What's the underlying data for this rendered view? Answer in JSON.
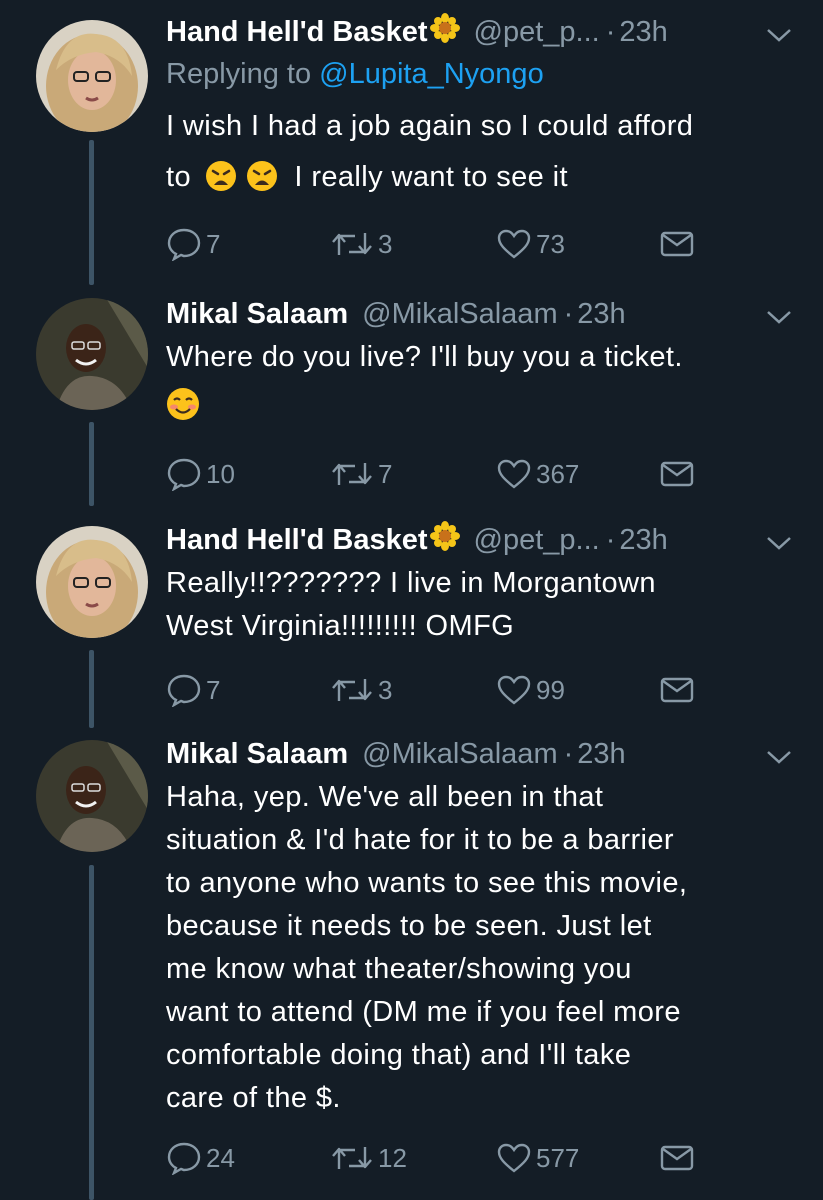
{
  "tweets": [
    {
      "name": "Hand Hell'd Basket",
      "handle": "@pet_p...",
      "dot": "·",
      "time": "23h",
      "replying_prefix": "Replying to ",
      "replying_to": "@Lupita_Nyongo",
      "lines": [
        "I wish I had a job again so I could afford",
        "to",
        "I really want to see it"
      ],
      "replies": "7",
      "retweets": "3",
      "likes": "73"
    },
    {
      "name": "Mikal Salaam",
      "handle": "@MikalSalaam",
      "dot": "·",
      "time": "23h",
      "lines": [
        "Where do you live? I'll buy you a ticket."
      ],
      "replies": "10",
      "retweets": "7",
      "likes": "367"
    },
    {
      "name": "Hand Hell'd Basket",
      "handle": "@pet_p...",
      "dot": "·",
      "time": "23h",
      "lines": [
        "Really!!??????? I live in Morgantown",
        "West Virginia!!!!!!!!! OMFG"
      ],
      "replies": "7",
      "retweets": "3",
      "likes": "99"
    },
    {
      "name": "Mikal Salaam",
      "handle": "@MikalSalaam",
      "dot": "·",
      "time": "23h",
      "lines": [
        "Haha, yep. We've all been in that",
        "situation & I'd hate for it to be a barrier",
        "to anyone who wants to see this movie,",
        "because it needs to be seen. Just let",
        "me know what theater/showing you",
        "want to attend (DM me if you feel more",
        "comfortable doing that) and I'll take",
        "care of the $."
      ],
      "replies": "24",
      "retweets": "12",
      "likes": "577"
    }
  ],
  "icons": {
    "reply": "reply-icon",
    "retweet": "retweet-icon",
    "like": "heart-icon",
    "dm": "envelope-icon",
    "caret": "chevron-down-icon",
    "flower": "sunflower-emoji",
    "weary": "weary-face-emoji",
    "smile": "smiling-face-emoji"
  },
  "colors": {
    "background": "#141d26",
    "text": "#ffffff",
    "secondary": "#8899a6",
    "link": "#1da1f2",
    "thread_line": "#3d5466"
  }
}
